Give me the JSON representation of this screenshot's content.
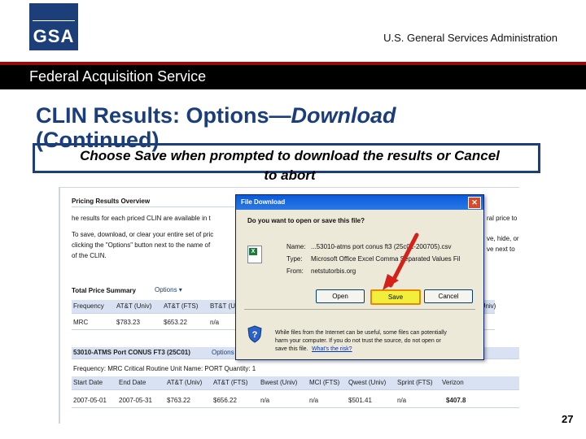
{
  "header": {
    "logo_text": "GSA",
    "agency": "U.S. General Services Administration",
    "division": "Federal Acquisition Service"
  },
  "slide": {
    "title_plain": "CLIN Results:  Options—",
    "title_italic": "Download",
    "title_line2": "(Continued)",
    "instruction_line1": "Choose Save when prompted to download the results or Cancel",
    "instruction_line2": "to abort",
    "page_number": "27"
  },
  "screenshot": {
    "overview_title": "Pricing Results Overview",
    "overview_text": [
      "he results for each priced CLIN are available in t",
      "To save, download, or clear your entire set of pric",
      "clicking the \"Options\" button next to the name of",
      "of the CLIN."
    ],
    "right_fragments": [
      "ral price to",
      "ve, hide, or",
      "ve next to"
    ],
    "summary_label": "Total Price Summary",
    "summary_options": "Options ▾",
    "summary_headers": [
      "Frequency",
      "AT&T (Univ)",
      "AT&T (FTS)",
      "BT&T (U"
    ],
    "summary_row": [
      "MRC",
      "$783.23",
      "$653.22",
      "n/a"
    ],
    "summary_right_header": "(Univ)",
    "clin_label": "53010-ATMS Port CONUS FT3 (25C01)",
    "clin_options": "Options",
    "clin_meta": "Frequency: MRC   Critical Routine   Unit Name: PORT   Quantity: 1",
    "clin_headers": [
      "Start Date",
      "End Date",
      "AT&T (Univ)",
      "AT&T (FTS)",
      "Bwest (Univ)",
      "MCI (FTS)",
      "Qwest (Univ)",
      "Sprint (FTS)",
      "Verizon"
    ],
    "clin_row": [
      "2007-05-01",
      "2007-05-31",
      "$763.22",
      "$656.22",
      "n/a",
      "n/a",
      "$501.41",
      "n/a",
      "$407.8"
    ]
  },
  "dialog": {
    "title": "File Download",
    "question": "Do you want to open or save this file?",
    "name_label": "Name:",
    "name_value": "...53010-atms port conus ft3 (25c01-200705).csv",
    "type_label": "Type:",
    "type_value": "Microsoft Office Excel Comma Separated Values Fil",
    "from_label": "From:",
    "from_value": "netstutorbis.org",
    "open_button": "Open",
    "save_button": "Save",
    "cancel_button": "Cancel",
    "warning_line1": "While files from the Internet can be useful, some files can potentially",
    "warning_line2": "harm your computer. If you do not trust the source, do not open or",
    "warning_line3": "save this file.",
    "warning_link": "What's the risk?"
  },
  "colors": {
    "brand_blue": "#1c3f7a",
    "band_black": "#000000",
    "band_red": "#9a0a0a",
    "title_blue": "#1a3d7c",
    "save_highlight": "#f2ef3c",
    "arrow_red": "#d4211a"
  }
}
